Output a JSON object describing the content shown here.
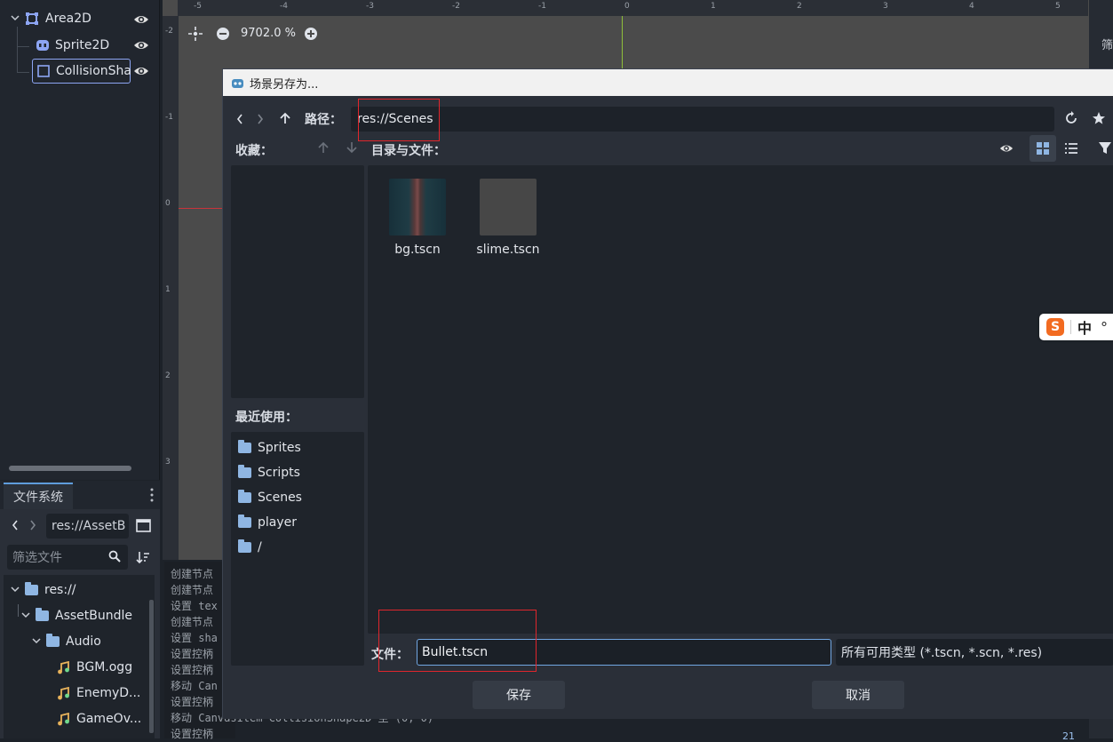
{
  "scene_tree": {
    "nodes": [
      {
        "label": "Area2D",
        "icon": "area2d-icon"
      },
      {
        "label": "Sprite2D",
        "icon": "sprite2d-icon"
      },
      {
        "label": "CollisionSha",
        "icon": "collisionshape-icon"
      }
    ]
  },
  "filesystem": {
    "tab_label": "文件系统",
    "path": "res://AssetB",
    "filter_placeholder": "筛选文件",
    "tree": [
      {
        "label": "res://",
        "icon": "folder-icon"
      },
      {
        "label": "AssetBundle",
        "icon": "folder-icon"
      },
      {
        "label": "Audio",
        "icon": "folder-icon"
      },
      {
        "label": "BGM.ogg",
        "icon": "audio-file-icon"
      },
      {
        "label": "EnemyD...",
        "icon": "audio-file-icon"
      },
      {
        "label": "GameOv...",
        "icon": "audio-file-icon"
      }
    ]
  },
  "viewport": {
    "zoom": "9702.0 %",
    "ruler_top": [
      "-5",
      "-4",
      "-3",
      "-2",
      "-1",
      "0",
      "1",
      "2",
      "3",
      "4",
      "5"
    ],
    "ruler_left": [
      "-2",
      "-1",
      "0",
      "1",
      "2",
      "3"
    ]
  },
  "log": {
    "lines": [
      "创建节点",
      "创建节点",
      "设置 tex",
      "创建节点",
      "设置 sha",
      "设置控柄",
      "设置控柄",
      "移动 Can",
      "设置控柄",
      "移动 CanvasItem CollisionShape2D 至 (0, 0)",
      "设置控柄"
    ]
  },
  "dialog": {
    "title": "场景另存为...",
    "path_label": "路径：",
    "path_value": "res://Scenes",
    "favorites_label": "收藏：",
    "dirs_label": "目录与文件：",
    "recent_label": "最近使用：",
    "recent_items": [
      "Sprites",
      "Scripts",
      "Scenes",
      "player",
      "/"
    ],
    "files": [
      {
        "name": "bg.tscn"
      },
      {
        "name": "slime.tscn"
      }
    ],
    "file_label": "文件：",
    "file_value": "Bullet.tscn",
    "filter_value": "所有可用类型 (*.tscn, *.scn, *.res)",
    "save_label": "保存",
    "cancel_label": "取消"
  },
  "right_strip": {
    "top_label": "筛",
    "bottom_value": "21"
  },
  "ime": {
    "logo": "S",
    "mode": "中",
    "punct": "°"
  },
  "colors": {
    "accent": "#71a6e2",
    "highlight_red": "#e0262c"
  }
}
